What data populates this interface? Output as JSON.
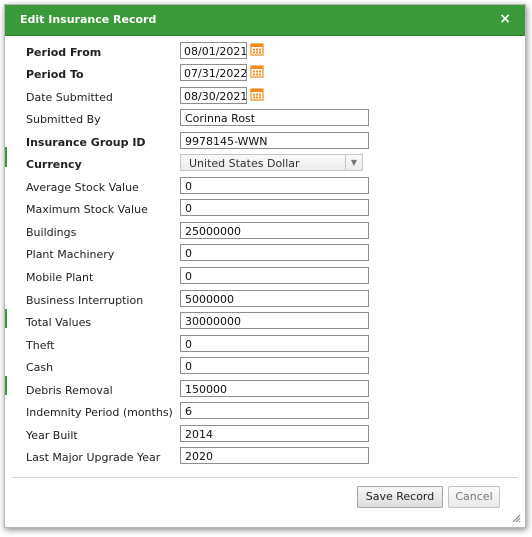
{
  "dialog": {
    "title": "Edit Insurance Record",
    "close_label": "×"
  },
  "colors": {
    "titlebar": "#3a9a3a",
    "calendar_icon": "#f08c1e"
  },
  "fields": {
    "period_from": {
      "label": "Period From",
      "value": "08/01/2021"
    },
    "period_to": {
      "label": "Period To",
      "value": "07/31/2022"
    },
    "date_submitted": {
      "label": "Date Submitted",
      "value": "08/30/2021"
    },
    "submitted_by": {
      "label": "Submitted By",
      "value": "Corinna Rost"
    },
    "insurance_group_id": {
      "label": "Insurance Group ID",
      "value": "9978145-WWN"
    },
    "currency": {
      "label": "Currency",
      "value": "United States Dollar"
    },
    "average_stock_value": {
      "label": "Average Stock Value",
      "value": "0"
    },
    "maximum_stock_value": {
      "label": "Maximum Stock Value",
      "value": "0"
    },
    "buildings": {
      "label": "Buildings",
      "value": "25000000"
    },
    "plant_machinery": {
      "label": "Plant Machinery",
      "value": "0"
    },
    "mobile_plant": {
      "label": "Mobile Plant",
      "value": "0"
    },
    "business_interruption": {
      "label": "Business Interruption",
      "value": "5000000"
    },
    "total_values": {
      "label": "Total Values",
      "value": "30000000"
    },
    "theft": {
      "label": "Theft",
      "value": "0"
    },
    "cash": {
      "label": "Cash",
      "value": "0"
    },
    "debris_removal": {
      "label": "Debris Removal",
      "value": "150000"
    },
    "indemnity_period": {
      "label": "Indemnity Period (months)",
      "value": "6"
    },
    "year_built": {
      "label": "Year Built",
      "value": "2014"
    },
    "last_major_upgrade_year": {
      "label": "Last Major Upgrade Year",
      "value": "2020"
    }
  },
  "buttons": {
    "save": "Save Record",
    "cancel": "Cancel"
  },
  "icons": {
    "calendar": "calendar-icon",
    "close": "close-icon",
    "dropdown": "chevron-down-icon",
    "resize": "resize-grip-icon"
  }
}
